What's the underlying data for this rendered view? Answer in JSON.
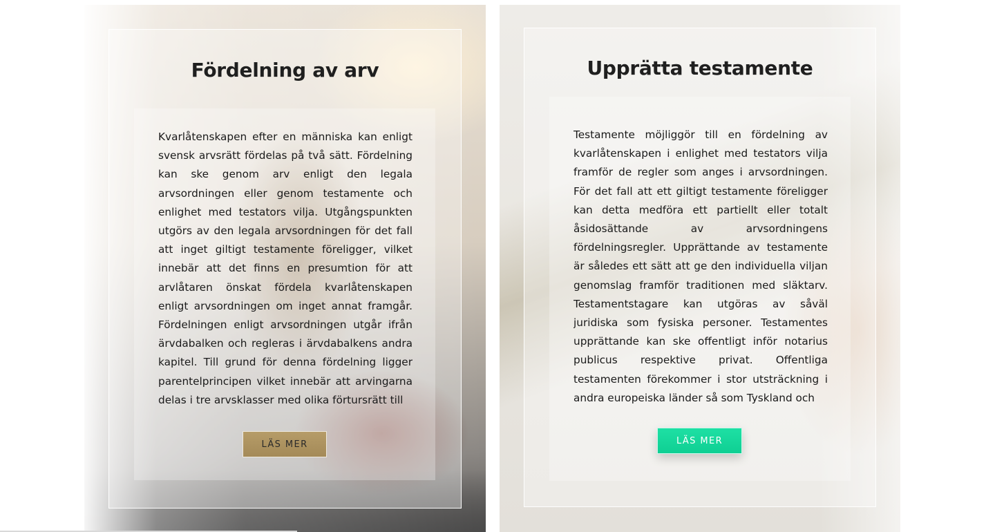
{
  "cards": [
    {
      "title": "Fördelning av arv",
      "body": "Kvarlåtenskapen efter en människa kan enligt svensk arvsrätt fördelas på två sätt. Fördelning kan ske genom arv enligt den legala arvsordningen eller genom testamente och enlighet med testators vilja. Utgångspunkten utgörs av den legala arvsordningen för det fall att inget giltigt testamente föreligger, vilket innebär att det finns en presumtion för att arvlåtaren önskat fördela kvarlåtenskapen enligt arvsordningen om inget annat framgår. Fördelningen enligt arvsordningen utgår ifrån ärvdabalken och regleras i ärvdabalkens andra kapitel. Till grund för denna fördelning ligger parentelprincipen vilket innebär att arvingarna delas i tre arvsklasser med olika förtursrätt till",
      "button_label": "LÄS MER",
      "button_color": "#a48a58"
    },
    {
      "title": "Upprätta testamente",
      "body": "Testamente möjliggör till en fördelning av kvarlåtenskapen i enlighet med testators vilja framför de regler som anges i arvsordningen. För det fall att ett giltigt testamente föreligger kan detta medföra ett partiellt eller totalt åsidosättande av arvsordningens fördelningsregler. Upprättande av testamente är således ett sätt att ge den individuella viljan genomslag framför traditionen med släktarv. Testamentstagare kan utgöras av såväl juridiska som fysiska personer. Testamentes upprättande kan ske offentligt inför notarius publicus respektive privat. Offentliga testamenten förekommer i stor utsträckning i andra europeiska länder så som Tyskland och",
      "button_label": "LÄS MER",
      "button_color": "#12d597"
    }
  ]
}
